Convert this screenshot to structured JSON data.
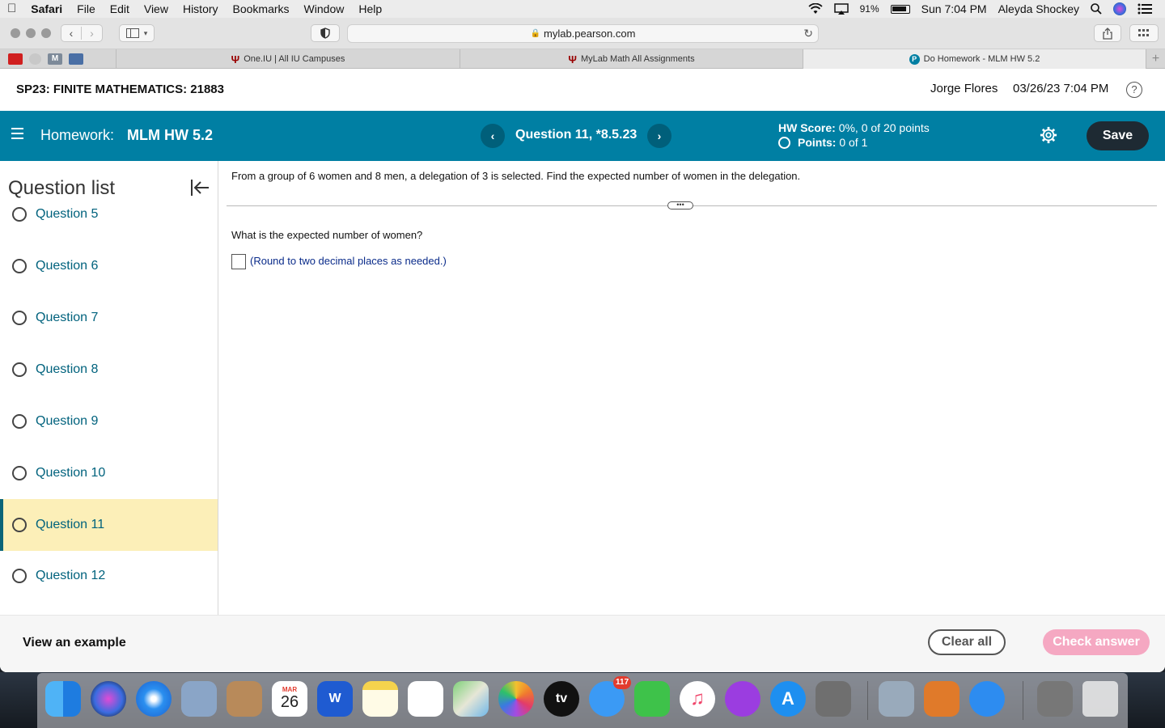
{
  "menubar": {
    "apple": "",
    "items": [
      "Safari",
      "File",
      "Edit",
      "View",
      "History",
      "Bookmarks",
      "Window",
      "Help"
    ],
    "battery": "91%",
    "clock": "Sun 7:04 PM",
    "user": "Aleyda Shockey"
  },
  "browser": {
    "url": "mylab.pearson.com",
    "tabs": [
      {
        "label": "One.IU | All IU Campuses"
      },
      {
        "label": "MyLab Math All Assignments"
      },
      {
        "label": "Do Homework - MLM HW 5.2"
      }
    ],
    "fav_m": "M"
  },
  "course": {
    "title": "SP23: FINITE MATHEMATICS: 21883",
    "user": "Jorge Flores",
    "datetime": "03/26/23 7:04 PM",
    "help": "?"
  },
  "homework": {
    "label": "Homework:",
    "name": "MLM HW 5.2",
    "prev": "‹",
    "next": "›",
    "question": "Question 11, *8.5.23",
    "score_label": "HW Score:",
    "score_value": "0%, 0 of 20 points",
    "points_label": "Points:",
    "points_value": "0 of 1",
    "save": "Save"
  },
  "sidebar": {
    "title": "Question list",
    "items": [
      {
        "label": "Question 5"
      },
      {
        "label": "Question 6"
      },
      {
        "label": "Question 7"
      },
      {
        "label": "Question 8"
      },
      {
        "label": "Question 9"
      },
      {
        "label": "Question 10"
      },
      {
        "label": "Question 11"
      },
      {
        "label": "Question 12"
      }
    ]
  },
  "problem": {
    "text": "From a group of 6 women and 8 men, a delegation of 3 is selected. Find the expected number of women in the delegation.",
    "ellipsis": "•••",
    "prompt": "What is the expected number of women?",
    "answer": "",
    "note": "(Round to two decimal places as needed.)"
  },
  "footer": {
    "view_example": "View an example",
    "clear_all": "Clear all",
    "check_answer": "Check answer"
  },
  "dock": {
    "calendar_month": "MAR",
    "calendar_day": "26",
    "word": "W",
    "tv": "tv",
    "messages_badge": "117"
  }
}
